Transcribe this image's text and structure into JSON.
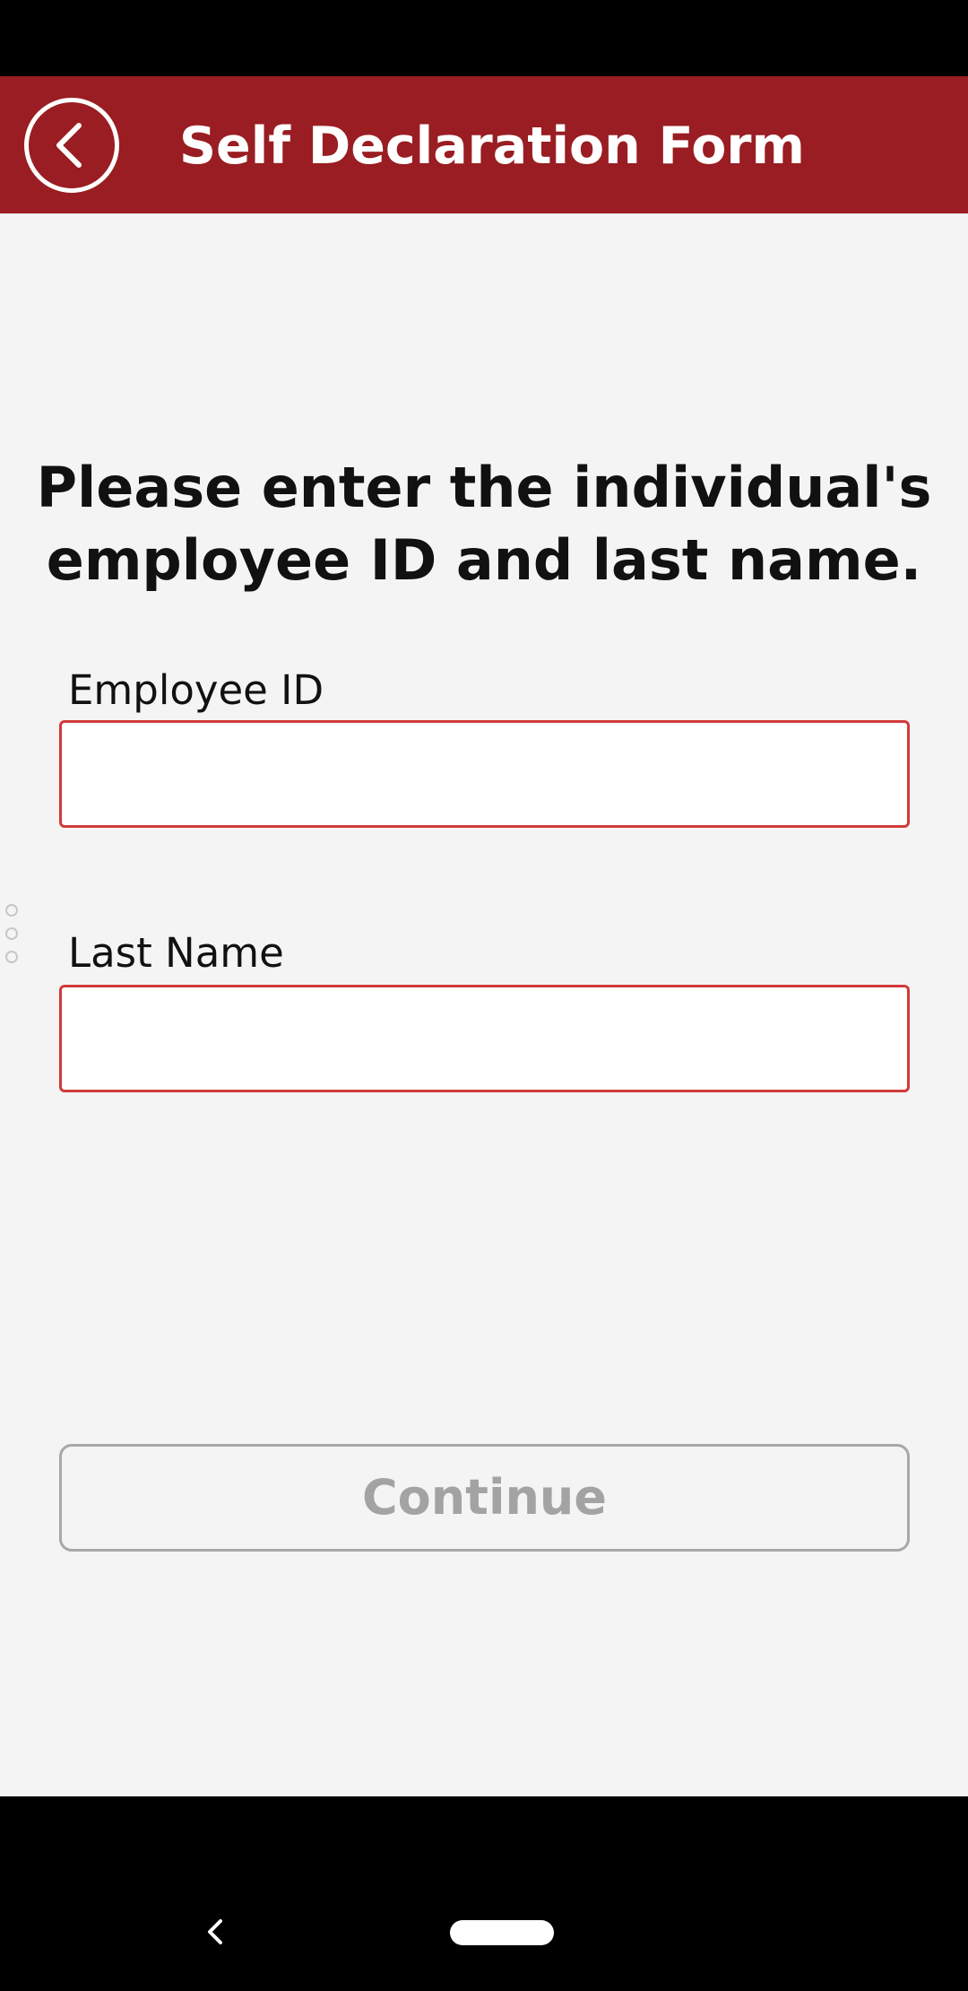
{
  "header": {
    "title": "Self Declaration Form",
    "back_icon": "chevron-left-circle-icon",
    "background_color": "#991d22"
  },
  "form": {
    "instruction": "Please enter the individual's employee ID and last name.",
    "employee_id": {
      "label": "Employee ID",
      "value": ""
    },
    "last_name": {
      "label": "Last Name",
      "value": ""
    },
    "continue_label": "Continue",
    "continue_enabled": false,
    "field_border_color": "#d23a3a"
  },
  "system_nav": {
    "back_icon": "nav-back-icon",
    "home_icon": "home-pill-icon"
  }
}
